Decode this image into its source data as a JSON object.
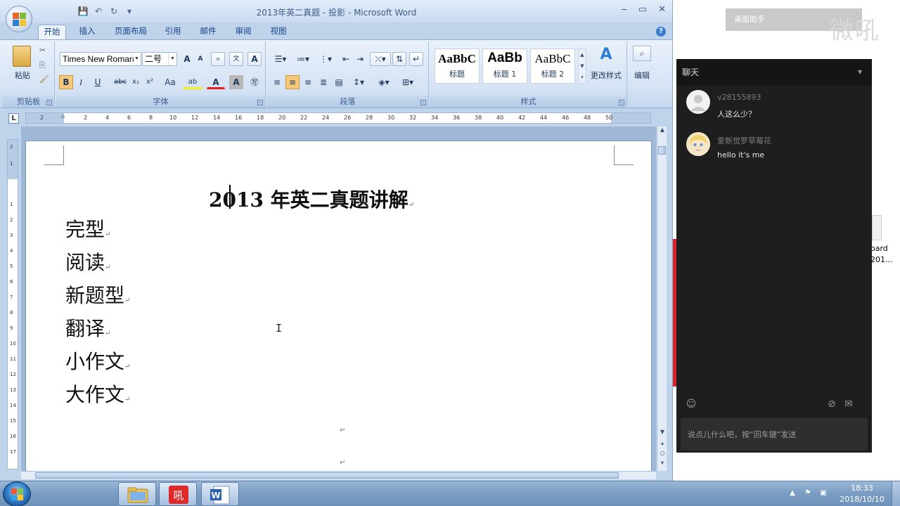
{
  "window": {
    "title": "2013年英二真题 - 投影 - Microsoft Word"
  },
  "ribbon": {
    "tabs": [
      "开始",
      "插入",
      "页面布局",
      "引用",
      "邮件",
      "审阅",
      "视图"
    ],
    "active_tab": "开始",
    "clipboard": {
      "paste_label": "粘贴",
      "group_label": "剪贴板"
    },
    "font": {
      "font_name": "Times New Roman",
      "font_size": "二号",
      "group_label": "字体",
      "bold": "B",
      "italic": "I",
      "underline": "U",
      "change_case": "Aa",
      "grow": "A",
      "shrink": "A"
    },
    "paragraph": {
      "group_label": "段落"
    },
    "styles": {
      "group_label": "样式",
      "items": [
        {
          "sample": "AaBbC",
          "name": "标题"
        },
        {
          "sample": "AaBb",
          "name": "标题 1"
        },
        {
          "sample": "AaBbC",
          "name": "标题 2"
        }
      ],
      "change_styles": "更改样式"
    },
    "editing": {
      "label": "编辑"
    }
  },
  "ruler": {
    "numbers": [
      "2",
      "2",
      "4",
      "6",
      "8",
      "10",
      "12",
      "14",
      "16",
      "18",
      "20",
      "22",
      "24",
      "26",
      "28",
      "30",
      "32",
      "34",
      "36",
      "38",
      "40",
      "42",
      "44",
      "46",
      "48",
      "50"
    ],
    "vnumbers": [
      "2",
      "1",
      "1",
      "2",
      "3",
      "4",
      "5",
      "6",
      "7",
      "8",
      "9",
      "10",
      "11",
      "12",
      "13",
      "14",
      "15",
      "16",
      "17"
    ]
  },
  "document": {
    "heading": "2013 年英二真题讲解",
    "lines": [
      "完型",
      "阅读",
      "新题型",
      "翻译",
      "小作文",
      "大作文"
    ],
    "paragraph_mark": "↵"
  },
  "desktop": {
    "helper": "桌面助手",
    "logo_text": "微吼",
    "file_label_line1": "oard",
    "file_label_line2": "201..."
  },
  "chat": {
    "header": "聊天",
    "messages": [
      {
        "user": "v28155893",
        "text": "人这么少？"
      },
      {
        "user": "爱新觉罗草莓花",
        "text": "hello it's me"
      }
    ],
    "input_placeholder": "说点儿什么吧，按“回车键”发送"
  },
  "taskbar": {
    "time": "18:33",
    "date": "2018/10/10"
  },
  "colors": {
    "accent_red": "#d8232a",
    "ribbon_blue": "#bfd3ea",
    "chat_bg": "#1e1e1e"
  }
}
